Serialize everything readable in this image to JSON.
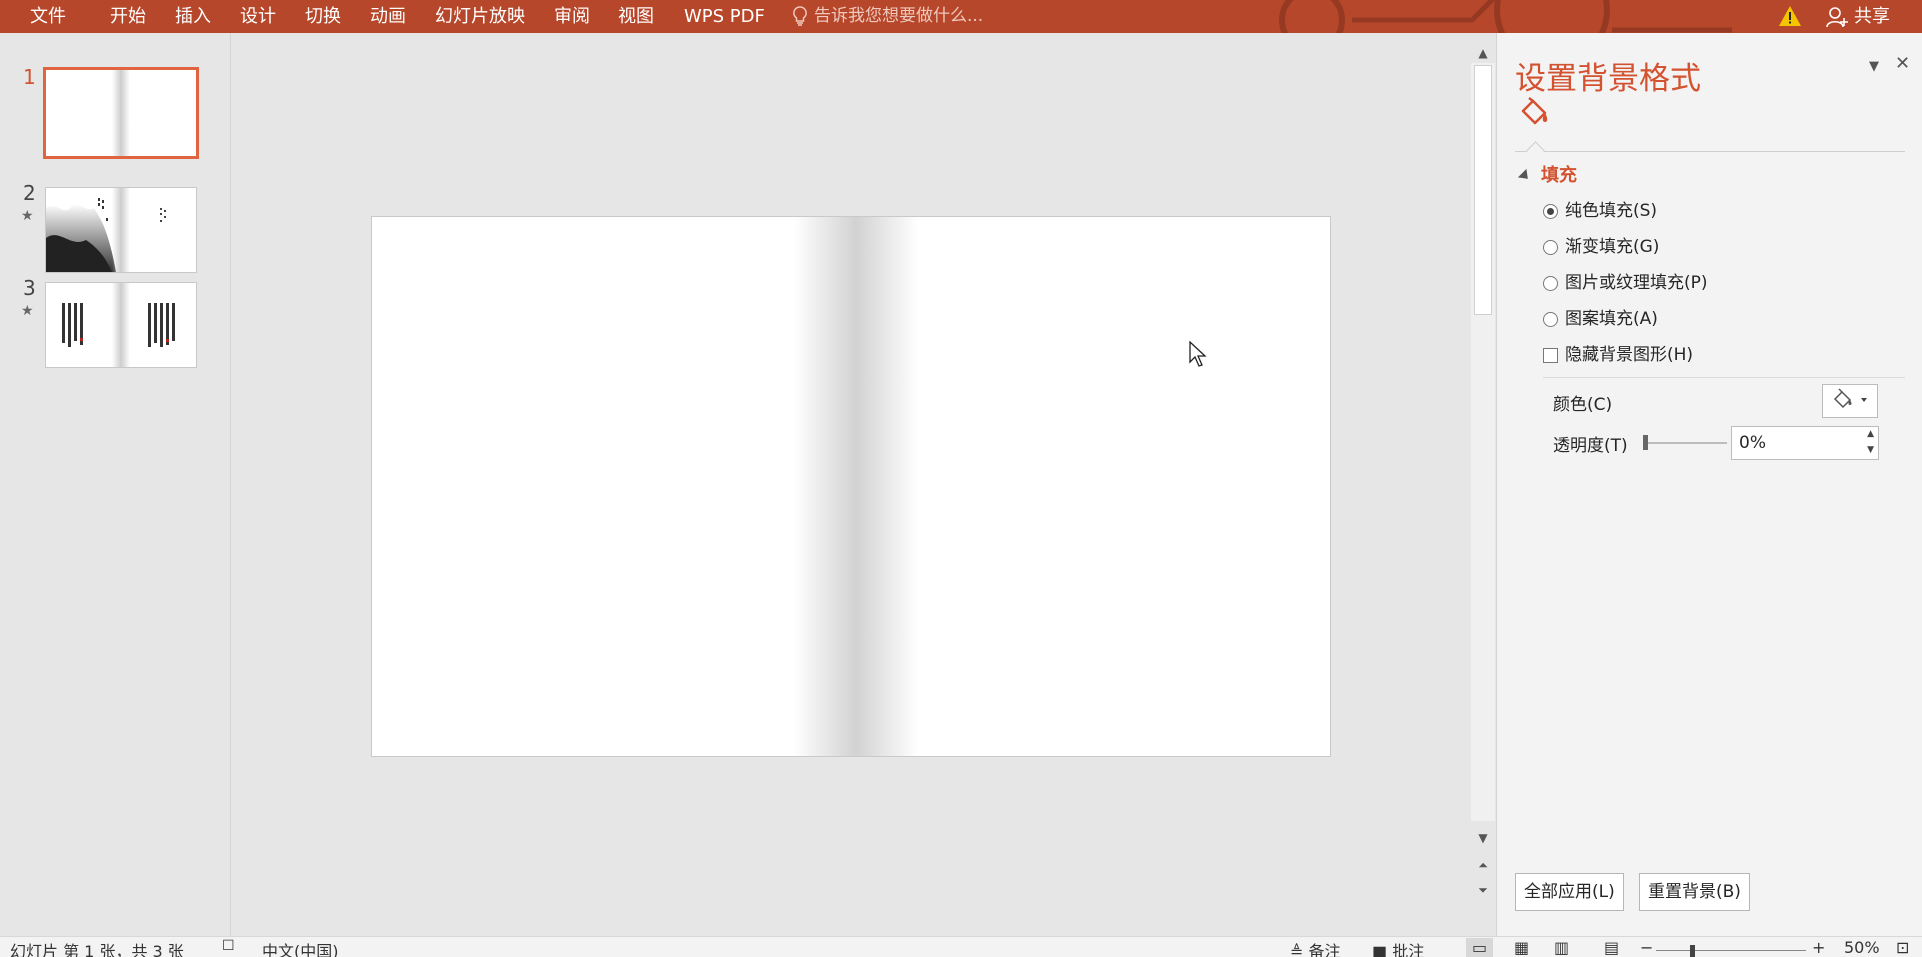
{
  "ribbon": {
    "tabs": [
      "文件",
      "开始",
      "插入",
      "设计",
      "切换",
      "动画",
      "幻灯片放映",
      "审阅",
      "视图",
      "WPS PDF"
    ],
    "tell_me": "告诉我您想要做什么...",
    "share": "共享",
    "icons": [
      "lightbulb-icon",
      "warning-icon",
      "user-icon"
    ]
  },
  "thumbnails": [
    {
      "number": "1",
      "selected": true,
      "animated": false
    },
    {
      "number": "2",
      "selected": false,
      "animated": true,
      "star": "★"
    },
    {
      "number": "3",
      "selected": false,
      "animated": true,
      "star": "★"
    }
  ],
  "panel": {
    "title": "设置背景格式",
    "section": "填充",
    "options": [
      {
        "label": "纯色填充(S)",
        "checked": true
      },
      {
        "label": "渐变填充(G)",
        "checked": false
      },
      {
        "label": "图片或纹理填充(P)",
        "checked": false
      },
      {
        "label": "图案填充(A)",
        "checked": false
      }
    ],
    "hide_background": "隐藏背景图形(H)",
    "color_label": "颜色(C)",
    "transparency_label": "透明度(T)",
    "transparency_value": "0%",
    "transparency_level": 0,
    "apply_all": "全部应用(L)",
    "reset_background": "重置背景(B)"
  },
  "status": {
    "slide_info": "幻灯片 第 1 张，共 3 张",
    "language": "中文(中国)",
    "notes": "备注",
    "comments": "批注",
    "zoom": "50%"
  },
  "colors": {
    "accent": "#b7472a",
    "title": "#d35230",
    "selection": "#e0643f"
  }
}
